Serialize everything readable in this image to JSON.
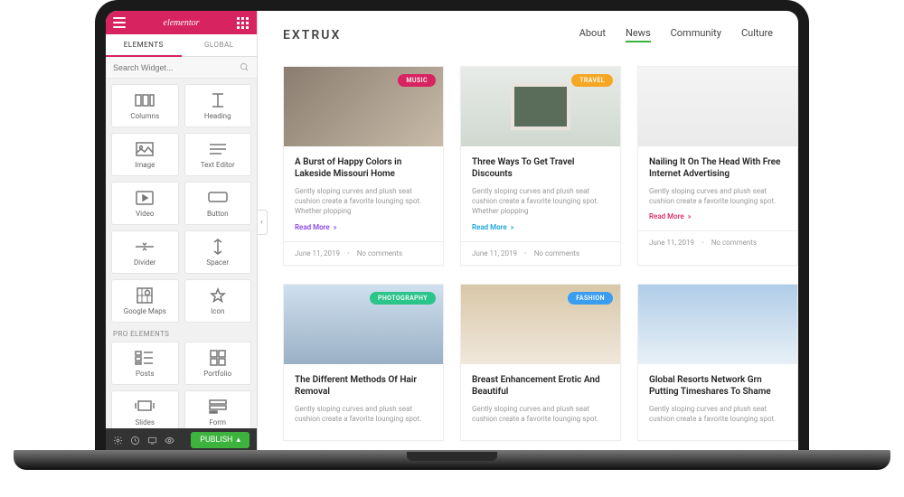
{
  "editor": {
    "brand": "elementor",
    "tabs": [
      "ELEMENTS",
      "GLOBAL"
    ],
    "search_placeholder": "Search Widget...",
    "basic_widgets": [
      {
        "label": "Columns"
      },
      {
        "label": "Heading"
      },
      {
        "label": "Image"
      },
      {
        "label": "Text Editor"
      },
      {
        "label": "Video"
      },
      {
        "label": "Button"
      },
      {
        "label": "Divider"
      },
      {
        "label": "Spacer"
      },
      {
        "label": "Google Maps"
      },
      {
        "label": "Icon"
      }
    ],
    "pro_section_title": "PRO ELEMENTS",
    "pro_widgets": [
      {
        "label": "Posts"
      },
      {
        "label": "Portfolio"
      },
      {
        "label": "Slides"
      },
      {
        "label": "Form"
      }
    ],
    "publish_label": "PUBLISH"
  },
  "page": {
    "brand": "EXTRUX",
    "nav": [
      "About",
      "News",
      "Community",
      "Culture"
    ],
    "nav_active": "News"
  },
  "cards_row1": [
    {
      "tag": "MUSIC",
      "tag_color": "#d7235f",
      "title": "A Burst of Happy Colors in Lakeside Missouri Home",
      "excerpt": "Gently sloping curves and plush seat cushion create a favorite lounging spot. Whether plopping",
      "read": "Read More",
      "read_color": "#8338ec",
      "date": "June 11, 2019",
      "comments": "No comments"
    },
    {
      "tag": "TRAVEL",
      "tag_color": "#f5a623",
      "title": "Three Ways To Get Travel Discounts",
      "excerpt": "Gently sloping curves and plush seat cushion create a favorite lounging spot. Whether plopping",
      "read": "Read More",
      "read_color": "#06a0d4",
      "date": "June 11, 2019",
      "comments": "No comments"
    },
    {
      "tag": "",
      "tag_color": "",
      "title": "Nailing It On The Head With Free Internet Advertising",
      "excerpt": "Gently sloping curves and plush seat cushion create a favorite lounging spot.",
      "read": "Read More",
      "read_color": "#d7235f",
      "date": "June 11, 2019",
      "comments": "No comments"
    }
  ],
  "cards_row2": [
    {
      "tag": "PHOTOGRAPHY",
      "tag_color": "#2bc48a",
      "title": "The Different Methods Of Hair Removal",
      "excerpt": "Gently sloping curves and plush seat cushion create a favorite lounging spot."
    },
    {
      "tag": "FASHION",
      "tag_color": "#3b9df0",
      "title": "Breast Enhancement Erotic And Beautiful",
      "excerpt": "Gently sloping curves and plush seat cushion create a favorite lounging spot."
    },
    {
      "tag": "",
      "tag_color": "",
      "title": "Global Resorts Network Grn Putting Timeshares To Shame",
      "excerpt": "Gently sloping curves and plush seat cushion create a favorite lounging spot."
    }
  ]
}
